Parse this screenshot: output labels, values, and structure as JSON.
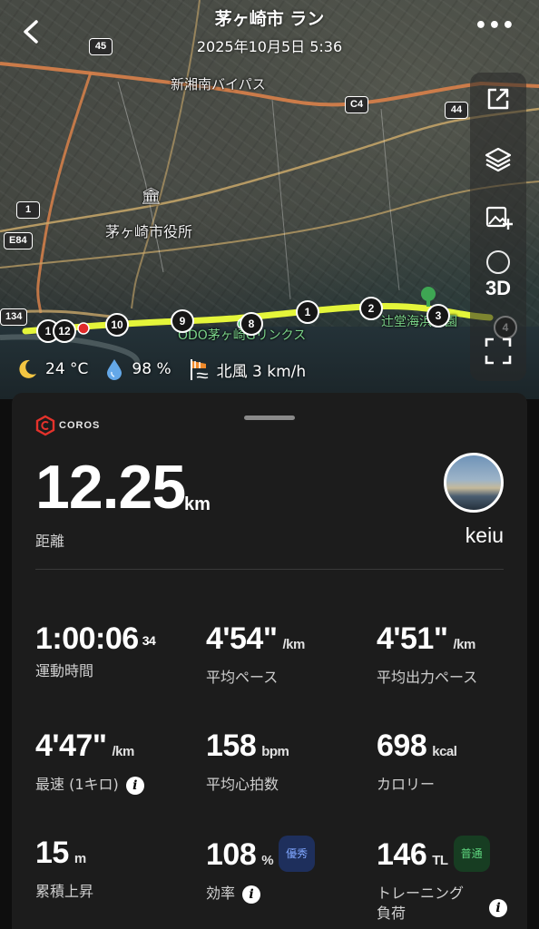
{
  "header": {
    "back_icon": "chevron-left-icon",
    "title": "茅ヶ崎市 ラン",
    "datetime": "2025年10月5日 5:36",
    "more_icon": "more-dots-icon"
  },
  "map": {
    "labels": {
      "bypass": "新湘南バイパス",
      "city_hall": "茅ヶ崎市役所",
      "golf": "ODO茅ヶ崎Gリンクス",
      "park": "辻堂海浜公園"
    },
    "road_badges": [
      "45",
      "C4",
      "44",
      "1",
      "E84",
      "134"
    ],
    "km_markers": [
      "1",
      "12",
      "10",
      "9",
      "8",
      "1",
      "2",
      "3",
      "4"
    ],
    "tools": {
      "share_icon": "share-icon",
      "layers_icon": "layers-icon",
      "image_add_icon": "image-add-icon",
      "view_3d_label": "3D",
      "fullscreen_icon": "fullscreen-icon"
    },
    "route_color": "#e4f53a"
  },
  "weather": {
    "temperature": "24 °C",
    "humidity": "98 %",
    "wind": "北風 3 km/h"
  },
  "summary": {
    "brand": "COROS",
    "distance_value": "12.25",
    "distance_unit": "km",
    "distance_label": "距離",
    "username": "keiu"
  },
  "stats": {
    "moving_time": {
      "value": "1:00:06",
      "fraction": "34",
      "label": "運動時間"
    },
    "avg_pace": {
      "value": "4'54\"",
      "unit": "/km",
      "label": "平均ペース"
    },
    "avg_power_pace": {
      "value": "4'51\"",
      "unit": "/km",
      "label": "平均出力ペース"
    },
    "best_km": {
      "value": "4'47\"",
      "unit": "/km",
      "label": "最速 (1キロ)"
    },
    "avg_hr": {
      "value": "158",
      "unit": "bpm",
      "label": "平均心拍数"
    },
    "calories": {
      "value": "698",
      "unit": "kcal",
      "label": "カロリー"
    },
    "elevation_gain": {
      "value": "15",
      "unit": "m",
      "label": "累積上昇"
    },
    "efficiency": {
      "value": "108",
      "unit": "%",
      "badge": "優秀",
      "label": "効率"
    },
    "training_load": {
      "value": "146",
      "unit": "TL",
      "badge": "普通",
      "label_line1": "トレーニング",
      "label_line2": "負荷"
    }
  },
  "colors": {
    "background": "#0e0e0e",
    "sheet": "#1c1c1c",
    "badge_blue": "#7fa6ff",
    "badge_green": "#5ed67f"
  }
}
